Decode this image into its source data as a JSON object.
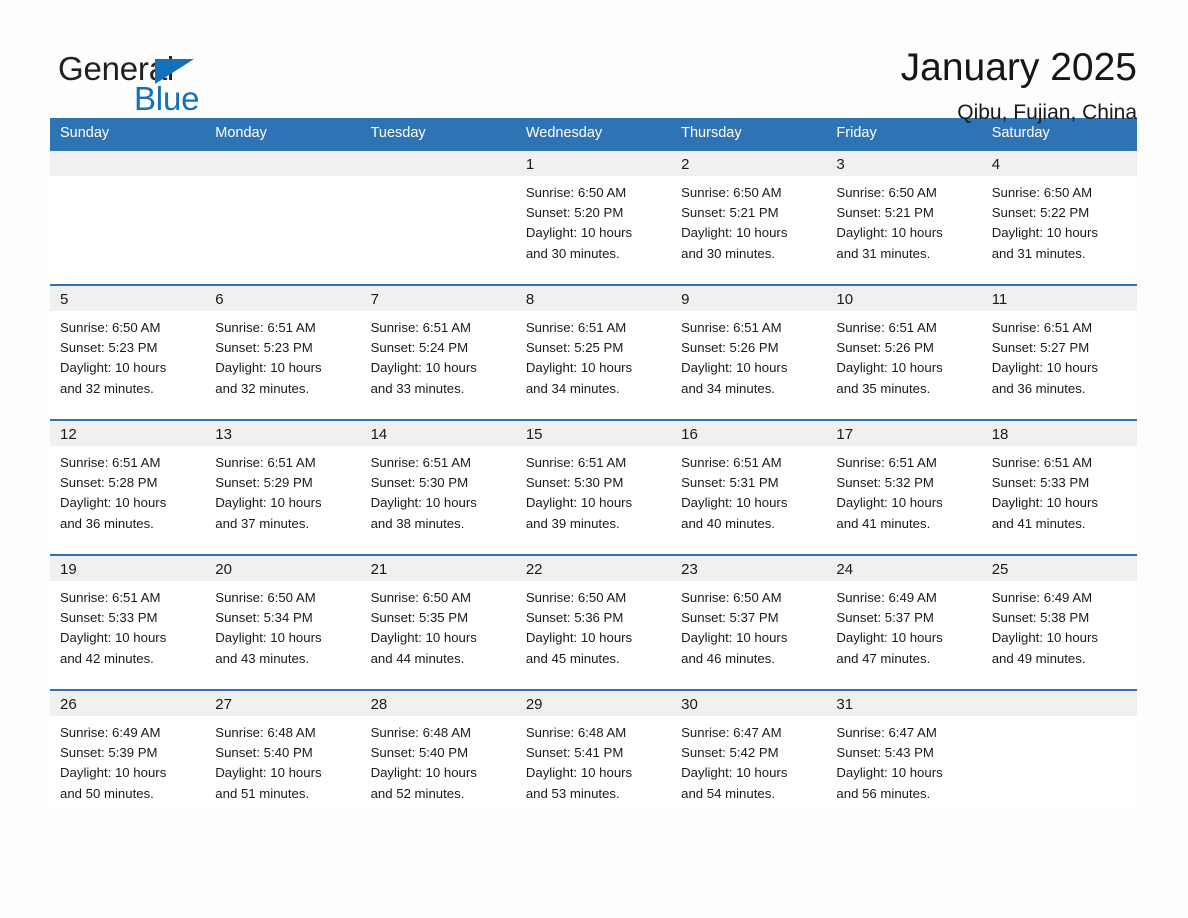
{
  "brand": {
    "name_part1": "General",
    "name_part2": "Blue",
    "accent_color": "#1271b8"
  },
  "header": {
    "title": "January 2025",
    "location": "Qibu, Fujian, China"
  },
  "theme": {
    "header_blue": "#2e74b5",
    "date_band_gray": "#f0f0f0",
    "page_background": "#fdfdfd"
  },
  "weekday_headers": [
    "Sunday",
    "Monday",
    "Tuesday",
    "Wednesday",
    "Thursday",
    "Friday",
    "Saturday"
  ],
  "labels": {
    "sunrise_prefix": "Sunrise:",
    "sunset_prefix": "Sunset:",
    "daylight_prefix": "Daylight:"
  },
  "weeks": [
    [
      {
        "date": "",
        "empty": true,
        "line1": "",
        "line2": "",
        "line3": "",
        "line4": ""
      },
      {
        "date": "",
        "empty": true,
        "line1": "",
        "line2": "",
        "line3": "",
        "line4": ""
      },
      {
        "date": "",
        "empty": true,
        "line1": "",
        "line2": "",
        "line3": "",
        "line4": ""
      },
      {
        "date": "1",
        "empty": false,
        "line1": "Sunrise: 6:50 AM",
        "line2": "Sunset: 5:20 PM",
        "line3": "Daylight: 10 hours",
        "line4": "and 30 minutes."
      },
      {
        "date": "2",
        "empty": false,
        "line1": "Sunrise: 6:50 AM",
        "line2": "Sunset: 5:21 PM",
        "line3": "Daylight: 10 hours",
        "line4": "and 30 minutes."
      },
      {
        "date": "3",
        "empty": false,
        "line1": "Sunrise: 6:50 AM",
        "line2": "Sunset: 5:21 PM",
        "line3": "Daylight: 10 hours",
        "line4": "and 31 minutes."
      },
      {
        "date": "4",
        "empty": false,
        "line1": "Sunrise: 6:50 AM",
        "line2": "Sunset: 5:22 PM",
        "line3": "Daylight: 10 hours",
        "line4": "and 31 minutes."
      }
    ],
    [
      {
        "date": "5",
        "empty": false,
        "line1": "Sunrise: 6:50 AM",
        "line2": "Sunset: 5:23 PM",
        "line3": "Daylight: 10 hours",
        "line4": "and 32 minutes."
      },
      {
        "date": "6",
        "empty": false,
        "line1": "Sunrise: 6:51 AM",
        "line2": "Sunset: 5:23 PM",
        "line3": "Daylight: 10 hours",
        "line4": "and 32 minutes."
      },
      {
        "date": "7",
        "empty": false,
        "line1": "Sunrise: 6:51 AM",
        "line2": "Sunset: 5:24 PM",
        "line3": "Daylight: 10 hours",
        "line4": "and 33 minutes."
      },
      {
        "date": "8",
        "empty": false,
        "line1": "Sunrise: 6:51 AM",
        "line2": "Sunset: 5:25 PM",
        "line3": "Daylight: 10 hours",
        "line4": "and 34 minutes."
      },
      {
        "date": "9",
        "empty": false,
        "line1": "Sunrise: 6:51 AM",
        "line2": "Sunset: 5:26 PM",
        "line3": "Daylight: 10 hours",
        "line4": "and 34 minutes."
      },
      {
        "date": "10",
        "empty": false,
        "line1": "Sunrise: 6:51 AM",
        "line2": "Sunset: 5:26 PM",
        "line3": "Daylight: 10 hours",
        "line4": "and 35 minutes."
      },
      {
        "date": "11",
        "empty": false,
        "line1": "Sunrise: 6:51 AM",
        "line2": "Sunset: 5:27 PM",
        "line3": "Daylight: 10 hours",
        "line4": "and 36 minutes."
      }
    ],
    [
      {
        "date": "12",
        "empty": false,
        "line1": "Sunrise: 6:51 AM",
        "line2": "Sunset: 5:28 PM",
        "line3": "Daylight: 10 hours",
        "line4": "and 36 minutes."
      },
      {
        "date": "13",
        "empty": false,
        "line1": "Sunrise: 6:51 AM",
        "line2": "Sunset: 5:29 PM",
        "line3": "Daylight: 10 hours",
        "line4": "and 37 minutes."
      },
      {
        "date": "14",
        "empty": false,
        "line1": "Sunrise: 6:51 AM",
        "line2": "Sunset: 5:30 PM",
        "line3": "Daylight: 10 hours",
        "line4": "and 38 minutes."
      },
      {
        "date": "15",
        "empty": false,
        "line1": "Sunrise: 6:51 AM",
        "line2": "Sunset: 5:30 PM",
        "line3": "Daylight: 10 hours",
        "line4": "and 39 minutes."
      },
      {
        "date": "16",
        "empty": false,
        "line1": "Sunrise: 6:51 AM",
        "line2": "Sunset: 5:31 PM",
        "line3": "Daylight: 10 hours",
        "line4": "and 40 minutes."
      },
      {
        "date": "17",
        "empty": false,
        "line1": "Sunrise: 6:51 AM",
        "line2": "Sunset: 5:32 PM",
        "line3": "Daylight: 10 hours",
        "line4": "and 41 minutes."
      },
      {
        "date": "18",
        "empty": false,
        "line1": "Sunrise: 6:51 AM",
        "line2": "Sunset: 5:33 PM",
        "line3": "Daylight: 10 hours",
        "line4": "and 41 minutes."
      }
    ],
    [
      {
        "date": "19",
        "empty": false,
        "line1": "Sunrise: 6:51 AM",
        "line2": "Sunset: 5:33 PM",
        "line3": "Daylight: 10 hours",
        "line4": "and 42 minutes."
      },
      {
        "date": "20",
        "empty": false,
        "line1": "Sunrise: 6:50 AM",
        "line2": "Sunset: 5:34 PM",
        "line3": "Daylight: 10 hours",
        "line4": "and 43 minutes."
      },
      {
        "date": "21",
        "empty": false,
        "line1": "Sunrise: 6:50 AM",
        "line2": "Sunset: 5:35 PM",
        "line3": "Daylight: 10 hours",
        "line4": "and 44 minutes."
      },
      {
        "date": "22",
        "empty": false,
        "line1": "Sunrise: 6:50 AM",
        "line2": "Sunset: 5:36 PM",
        "line3": "Daylight: 10 hours",
        "line4": "and 45 minutes."
      },
      {
        "date": "23",
        "empty": false,
        "line1": "Sunrise: 6:50 AM",
        "line2": "Sunset: 5:37 PM",
        "line3": "Daylight: 10 hours",
        "line4": "and 46 minutes."
      },
      {
        "date": "24",
        "empty": false,
        "line1": "Sunrise: 6:49 AM",
        "line2": "Sunset: 5:37 PM",
        "line3": "Daylight: 10 hours",
        "line4": "and 47 minutes."
      },
      {
        "date": "25",
        "empty": false,
        "line1": "Sunrise: 6:49 AM",
        "line2": "Sunset: 5:38 PM",
        "line3": "Daylight: 10 hours",
        "line4": "and 49 minutes."
      }
    ],
    [
      {
        "date": "26",
        "empty": false,
        "line1": "Sunrise: 6:49 AM",
        "line2": "Sunset: 5:39 PM",
        "line3": "Daylight: 10 hours",
        "line4": "and 50 minutes."
      },
      {
        "date": "27",
        "empty": false,
        "line1": "Sunrise: 6:48 AM",
        "line2": "Sunset: 5:40 PM",
        "line3": "Daylight: 10 hours",
        "line4": "and 51 minutes."
      },
      {
        "date": "28",
        "empty": false,
        "line1": "Sunrise: 6:48 AM",
        "line2": "Sunset: 5:40 PM",
        "line3": "Daylight: 10 hours",
        "line4": "and 52 minutes."
      },
      {
        "date": "29",
        "empty": false,
        "line1": "Sunrise: 6:48 AM",
        "line2": "Sunset: 5:41 PM",
        "line3": "Daylight: 10 hours",
        "line4": "and 53 minutes."
      },
      {
        "date": "30",
        "empty": false,
        "line1": "Sunrise: 6:47 AM",
        "line2": "Sunset: 5:42 PM",
        "line3": "Daylight: 10 hours",
        "line4": "and 54 minutes."
      },
      {
        "date": "31",
        "empty": false,
        "line1": "Sunrise: 6:47 AM",
        "line2": "Sunset: 5:43 PM",
        "line3": "Daylight: 10 hours",
        "line4": "and 56 minutes."
      },
      {
        "date": "",
        "empty": true,
        "line1": "",
        "line2": "",
        "line3": "",
        "line4": ""
      }
    ]
  ]
}
